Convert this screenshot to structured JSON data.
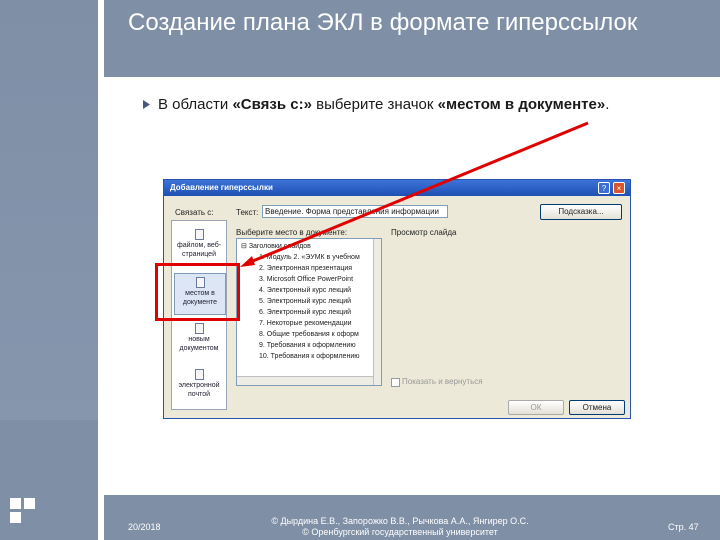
{
  "slide": {
    "title": "Создание плана ЭКЛ в формате гиперссылок",
    "bullet_parts": {
      "p1": "В области ",
      "b1": "«Связь с:»",
      "p2": " выберите значок ",
      "b2": "«местом в документе»",
      "p3": "."
    },
    "footer": {
      "date": "20/2018",
      "copy_line1": "© Дырдина Е.В., Запорожко В.В., Рычкова А.А., Янгирер О.С.",
      "copy_line2": "© Оренбургский государственный университет",
      "page": "Стр. 47"
    }
  },
  "dialog": {
    "title": "Добавление гиперссылки",
    "link_with_label": "Связать с:",
    "text_label": "Текст:",
    "text_value": "Введение. Форма представления информации",
    "tooltip_button": "Подсказка...",
    "select_place_label": "Выберите место в документе:",
    "preview_label": "Просмотр слайда",
    "link_bar": [
      "файлом, веб-страницей",
      "местом в документе",
      "новым документом",
      "электронной почтой"
    ],
    "tree": {
      "root": "Заголовки слайдов",
      "items": [
        "1. Модуль 2. «ЭУМК в учебном",
        "2. Электронная презентация",
        "3. Microsoft Office PowerPoint",
        "4. Электронный курс лекций",
        "5. Электронный курс лекций",
        "6. Электронный курс лекций",
        "7. Некоторые рекомендации",
        "8. Общие требования к оформ",
        "9. Требования к оформлению",
        "10. Требования к оформлению"
      ]
    },
    "show_return_label": "Показать и вернуться",
    "ok_label": "ОК",
    "cancel_label": "Отмена"
  }
}
